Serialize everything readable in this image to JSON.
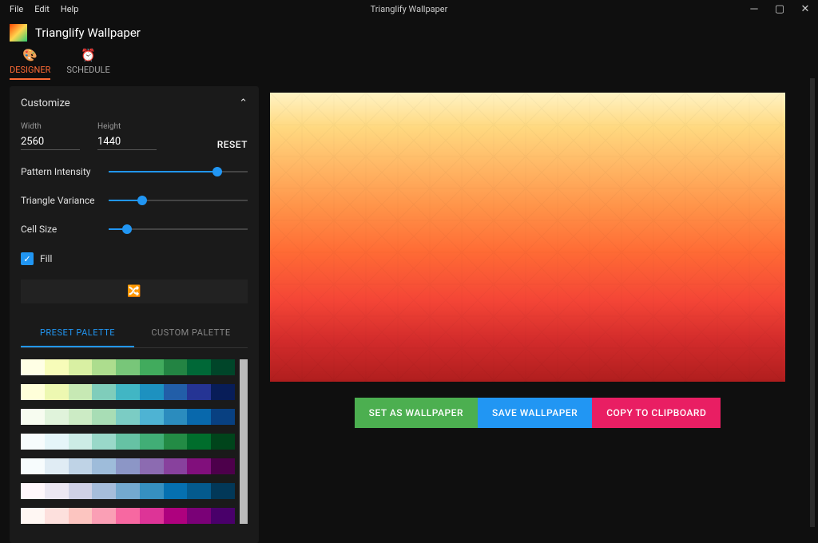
{
  "window": {
    "title": "Trianglify Wallpaper",
    "menu": [
      "File",
      "Edit",
      "Help"
    ]
  },
  "app": {
    "name": "Trianglify Wallpaper"
  },
  "nav": {
    "designer": "DESIGNER",
    "schedule": "SCHEDULE"
  },
  "customize": {
    "title": "Customize",
    "width_label": "Width",
    "width": "2560",
    "height_label": "Height",
    "height": "1440",
    "reset": "RESET",
    "pattern_intensity": {
      "label": "Pattern Intensity",
      "pct": 78
    },
    "triangle_variance": {
      "label": "Triangle Variance",
      "pct": 24
    },
    "cell_size": {
      "label": "Cell Size",
      "pct": 13
    },
    "fill_label": "Fill",
    "fill": true
  },
  "palette_tabs": {
    "preset": "PRESET PALETTE",
    "custom": "CUSTOM PALETTE"
  },
  "palettes": [
    [
      "#ffffe5",
      "#f7fcb9",
      "#d9f0a3",
      "#addd8e",
      "#78c679",
      "#41ab5d",
      "#238443",
      "#006837",
      "#004529"
    ],
    [
      "#ffffd9",
      "#edf8b1",
      "#c7e9b4",
      "#7fcdbb",
      "#41b6c4",
      "#1d91c0",
      "#225ea8",
      "#253494",
      "#081d58"
    ],
    [
      "#f7fcf0",
      "#e0f3db",
      "#ccebc5",
      "#a8ddb5",
      "#7bccc4",
      "#4eb3d3",
      "#2b8cbe",
      "#0868ac",
      "#084081"
    ],
    [
      "#f7fcfd",
      "#e5f5f9",
      "#ccece6",
      "#99d8c9",
      "#66c2a4",
      "#41ae76",
      "#238b45",
      "#006d2c",
      "#00441b"
    ],
    [
      "#f7fcfd",
      "#e0ecf4",
      "#bfd3e6",
      "#9ebcda",
      "#8c96c6",
      "#8c6bb1",
      "#88419d",
      "#810f7c",
      "#4d004b"
    ],
    [
      "#fff7fb",
      "#ece7f2",
      "#d0d1e6",
      "#a6bddb",
      "#74a9cf",
      "#3690c0",
      "#0570b0",
      "#045a8d",
      "#023858"
    ],
    [
      "#fff7f3",
      "#fde0dd",
      "#fcc5c0",
      "#fa9fb5",
      "#f768a1",
      "#dd3497",
      "#ae017e",
      "#7a0177",
      "#49006a"
    ]
  ],
  "actions": {
    "set": "SET AS WALLPAPER",
    "save": "SAVE WALLPAPER",
    "copy": "COPY TO CLIPBOARD"
  }
}
